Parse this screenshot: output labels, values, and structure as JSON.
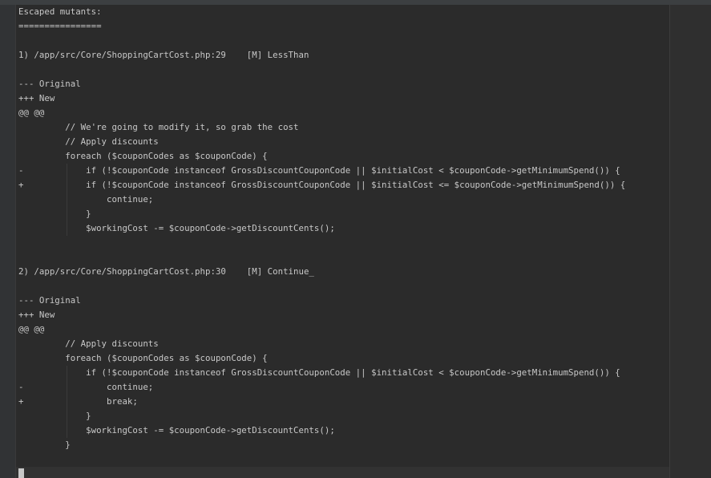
{
  "output": {
    "lines": [
      "Escaped mutants:",
      "================",
      "",
      "1) /app/src/Core/ShoppingCartCost.php:29    [M] LessThan",
      "",
      "--- Original",
      "+++ New",
      "@@ @@",
      "         // We're going to modify it, so grab the cost",
      "         // Apply discounts",
      "         foreach ($couponCodes as $couponCode) {",
      "-            if (!$couponCode instanceof GrossDiscountCouponCode || $initialCost < $couponCode->getMinimumSpend()) {",
      "+            if (!$couponCode instanceof GrossDiscountCouponCode || $initialCost <= $couponCode->getMinimumSpend()) {",
      "                 continue;",
      "             }",
      "             $workingCost -= $couponCode->getDiscountCents();",
      "",
      "",
      "2) /app/src/Core/ShoppingCartCost.php:30    [M] Continue_",
      "",
      "--- Original",
      "+++ New",
      "@@ @@",
      "         // Apply discounts",
      "         foreach ($couponCodes as $couponCode) {",
      "             if (!$couponCode instanceof GrossDiscountCouponCode || $initialCost < $couponCode->getMinimumSpend()) {",
      "-                continue;",
      "+                break;",
      "             }",
      "             $workingCost -= $couponCode->getDiscountCents();",
      "         }"
    ]
  },
  "colors": {
    "background": "#2b2b2b",
    "text": "#c8c8c8",
    "gutter": "#313335"
  }
}
